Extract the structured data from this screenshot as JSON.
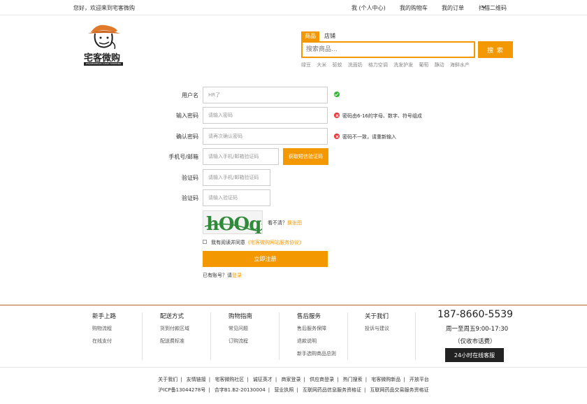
{
  "topbar": {
    "welcome": "您好，欢迎来到宅客微购",
    "links": [
      "我 (个人中心)",
      "我的购物车",
      "我的订单",
      "扫描二维码"
    ]
  },
  "logo": {
    "name": "宅客微购",
    "sub": "ZHAIKEWEIGOU  GOOD SHOPPING"
  },
  "search": {
    "tabs": [
      "商品",
      "店铺"
    ],
    "placeholder": "搜索商品...",
    "button": "搜 索",
    "hot_words": [
      "绿豆",
      "大米",
      "驱蚊",
      "洗面奶",
      "格力空调",
      "洗发护发",
      "葡萄",
      "静动",
      "海鲜水产"
    ]
  },
  "form": {
    "username": {
      "label": "用户名",
      "value": "HR了",
      "status": "ok"
    },
    "password": {
      "label": "输入密码",
      "placeholder": "请输入密码",
      "hint": "密码由6-16的字母、数字、符号组成"
    },
    "confirm": {
      "label": "确认密码",
      "placeholder": "请再次确认密码",
      "hint": "密码不一致，请重新输入"
    },
    "phone": {
      "label": "手机号/邮箱",
      "placeholder": "请输入手机/邮箱验证码",
      "sms_button": "获取短信验证码"
    },
    "code1": {
      "label": "验证码",
      "placeholder": "请输入手机/邮箱验证码"
    },
    "code2": {
      "label": "验证码",
      "placeholder": "请输入验证码"
    },
    "captcha": {
      "text": "hOOq",
      "prompt": "看不清？",
      "refresh": "换张图"
    },
    "agree": {
      "prefix": "我有阅读并同意",
      "link": "《宅客微购网站服务协议》"
    },
    "submit": "立即注册",
    "login": {
      "prefix": "已有账号？请",
      "link": "登录"
    }
  },
  "footer": {
    "columns": [
      {
        "head": "新手上路",
        "items": [
          "购物流程",
          "在线支付"
        ]
      },
      {
        "head": "配送方式",
        "items": [
          "货到付款区域",
          "配送费标准"
        ]
      },
      {
        "head": "购物指南",
        "items": [
          "常见问题",
          "订购流程"
        ]
      },
      {
        "head": "售后服务",
        "items": [
          "售后服务保障",
          "退款说明",
          "新手选购商品总则"
        ]
      },
      {
        "head": "关于我们",
        "items": [
          "投诉与建议"
        ]
      }
    ],
    "phone": "187-8660-5539",
    "hours": "周一至周五9:00-17:30",
    "fee": "（仅收市话费）",
    "service_button": "24小时在线客服",
    "links": [
      "关于我们",
      "友情链接",
      "宅客微购社区",
      "诚征英才",
      "商家登录",
      "供应商登录",
      "热门搜索",
      "宅客微购新品",
      "开放平台"
    ],
    "licenses": [
      "沪ICP备13044278号",
      "合字B1.B2-20130004",
      "营业执照",
      "互联网药品信息服务资格证",
      "互联网药品交易服务资格证"
    ]
  },
  "colors": {
    "accent": "#f39800",
    "ok": "#33b233",
    "error": "#e23a3a",
    "footer_rule": "#b5642d"
  }
}
